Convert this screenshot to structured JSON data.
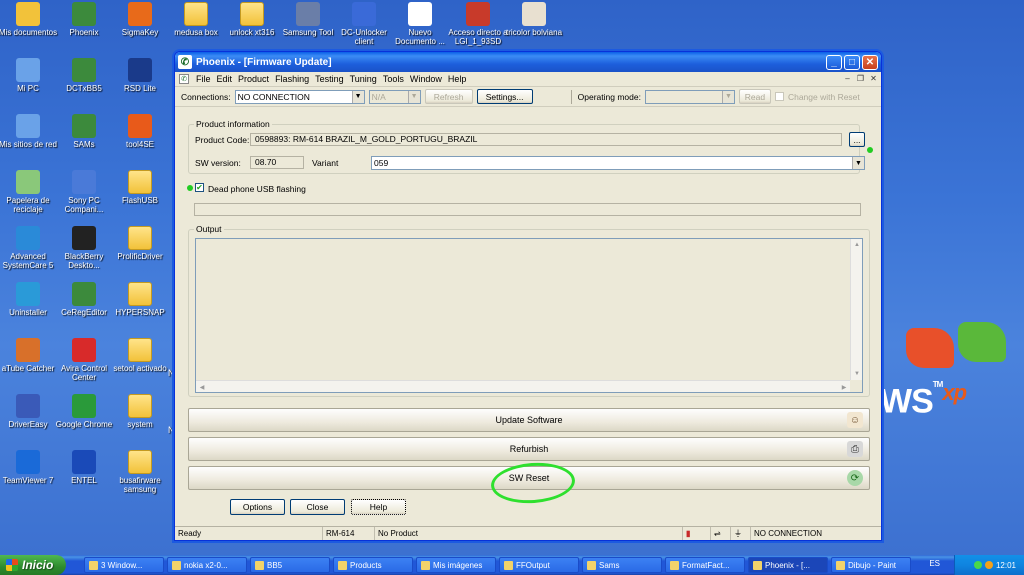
{
  "desktop": {
    "icons": [
      {
        "label": "Mis documentos",
        "icon": "folder-docs-icon",
        "color": "#f2c23a"
      },
      {
        "label": "Phoenix",
        "icon": "phoenix-icon",
        "color": "#3c8a3c"
      },
      {
        "label": "SigmaKey",
        "icon": "sigma-icon",
        "color": "#e86a1a"
      },
      {
        "label": "medusa box",
        "icon": "folder-icon",
        "color": "#f2c23a"
      },
      {
        "label": "unlock xt316",
        "icon": "folder-icon",
        "color": "#f2c23a"
      },
      {
        "label": "Samsung Tool",
        "icon": "gear-icon",
        "color": "#6a7ea8"
      },
      {
        "label": "DC-Unlocker client",
        "icon": "phone-icon",
        "color": "#3a6ad8"
      },
      {
        "label": "Nuevo Documento ...",
        "icon": "document-icon",
        "color": "#ffffff"
      },
      {
        "label": "Acceso directo a LGI_1_93SD",
        "icon": "shortcut-icon",
        "color": "#c83a2a"
      },
      {
        "label": "tricolor bolviana",
        "icon": "flag-doc-icon",
        "color": "#e8e0d0"
      },
      {
        "label": "Mi PC",
        "icon": "computer-icon",
        "color": "#6aa2e8"
      },
      {
        "label": "DCTxBB5",
        "icon": "dct-icon",
        "color": "#3c8a3c"
      },
      {
        "label": "RSD Lite",
        "icon": "motorola-icon",
        "color": "#1a3a8a"
      },
      {
        "label": "Mis sitios de red",
        "icon": "network-icon",
        "color": "#6aa2e8"
      },
      {
        "label": "SAMs",
        "icon": "sams-icon",
        "color": "#3c8a3c"
      },
      {
        "label": "tool4SE",
        "icon": "tool-icon",
        "color": "#e85a1a"
      },
      {
        "label": "Papelera de reciclaje",
        "icon": "recycle-bin-icon",
        "color": "#8ac87a"
      },
      {
        "label": "Sony PC Compani...",
        "icon": "sony-icon",
        "color": "#4a7ad8"
      },
      {
        "label": "FlashUSB",
        "icon": "folder-icon",
        "color": "#f2c23a"
      },
      {
        "label": "Advanced SystemCare 5",
        "icon": "systemcare-icon",
        "color": "#2a8ad8"
      },
      {
        "label": "BlackBerry Deskto...",
        "icon": "blackberry-icon",
        "color": "#222222"
      },
      {
        "label": "ProlificDriver",
        "icon": "folder-icon",
        "color": "#f2c23a"
      },
      {
        "label": "Uninstaller",
        "icon": "uninstaller-icon",
        "color": "#2a9ad8"
      },
      {
        "label": "CeRegEditor",
        "icon": "ceregeditor-icon",
        "color": "#3c8a3c"
      },
      {
        "label": "HYPERSNAP",
        "icon": "folder-icon",
        "color": "#f2c23a"
      },
      {
        "label": "aTube Catcher",
        "icon": "atube-icon",
        "color": "#d8702a"
      },
      {
        "label": "Avira Control Center",
        "icon": "avira-icon",
        "color": "#d82a2a"
      },
      {
        "label": "setool activado",
        "icon": "folder-icon",
        "color": "#f2c23a"
      },
      {
        "label": "DriverEasy",
        "icon": "drivereasy-icon",
        "color": "#3a5ab8"
      },
      {
        "label": "Google Chrome",
        "icon": "chrome-icon",
        "color": "#2a9a3a"
      },
      {
        "label": "system",
        "icon": "folder-icon",
        "color": "#f2c23a"
      },
      {
        "label": "TeamViewer 7",
        "icon": "teamviewer-icon",
        "color": "#1a6ad8"
      },
      {
        "label": "ENTEL",
        "icon": "entel-icon",
        "color": "#1a4ab8"
      },
      {
        "label": "busafirware samsung",
        "icon": "folder-icon",
        "color": "#f2c23a"
      }
    ],
    "side_fragments": [
      "N",
      "N"
    ],
    "xp_text": "WS",
    "xp_sup": "xp",
    "xp_tm": "TM"
  },
  "window": {
    "title": "Phoenix - [Firmware Update]",
    "menu": [
      "File",
      "Edit",
      "Product",
      "Flashing",
      "Testing",
      "Tuning",
      "Tools",
      "Window",
      "Help"
    ],
    "toolbar": {
      "connections_label": "Connections:",
      "connections_value": "NO CONNECTION",
      "na_value": "N/A",
      "refresh": "Refresh",
      "settings": "Settings...",
      "operating_mode_label": "Operating mode:",
      "read": "Read",
      "change_with_reset": "Change with Reset"
    },
    "product_info": {
      "group_label": "Product information",
      "product_code_label": "Product Code:",
      "product_code_value": "0598893: RM-614 BRAZIL_M_GOLD_PORTUGU_BRAZIL",
      "browse": "...",
      "sw_version_label": "SW version:",
      "sw_version_value": "08.70",
      "variant_label": "Variant",
      "variant_value": "059"
    },
    "dead_phone_label": "Dead phone USB flashing",
    "output_label": "Output",
    "buttons": {
      "update_software": "Update Software",
      "refurbish": "Refurbish",
      "sw_reset": "SW Reset",
      "options": "Options",
      "close": "Close",
      "help": "Help"
    },
    "status": {
      "ready": "Ready",
      "product": "RM-614",
      "no_product": "No Product",
      "connection": "NO CONNECTION"
    },
    "highlight_color": "#2ee02e"
  },
  "taskbar": {
    "start": "Inicio",
    "items": [
      "3 Window...",
      "nokia x2-0...",
      "BB5",
      "Products",
      "Mis imágenes",
      "FFOutput",
      "Sams",
      "FormatFact...",
      "Phoenix - [...",
      "Dibujo - Paint"
    ],
    "language": "ES",
    "clock": "12:01"
  }
}
